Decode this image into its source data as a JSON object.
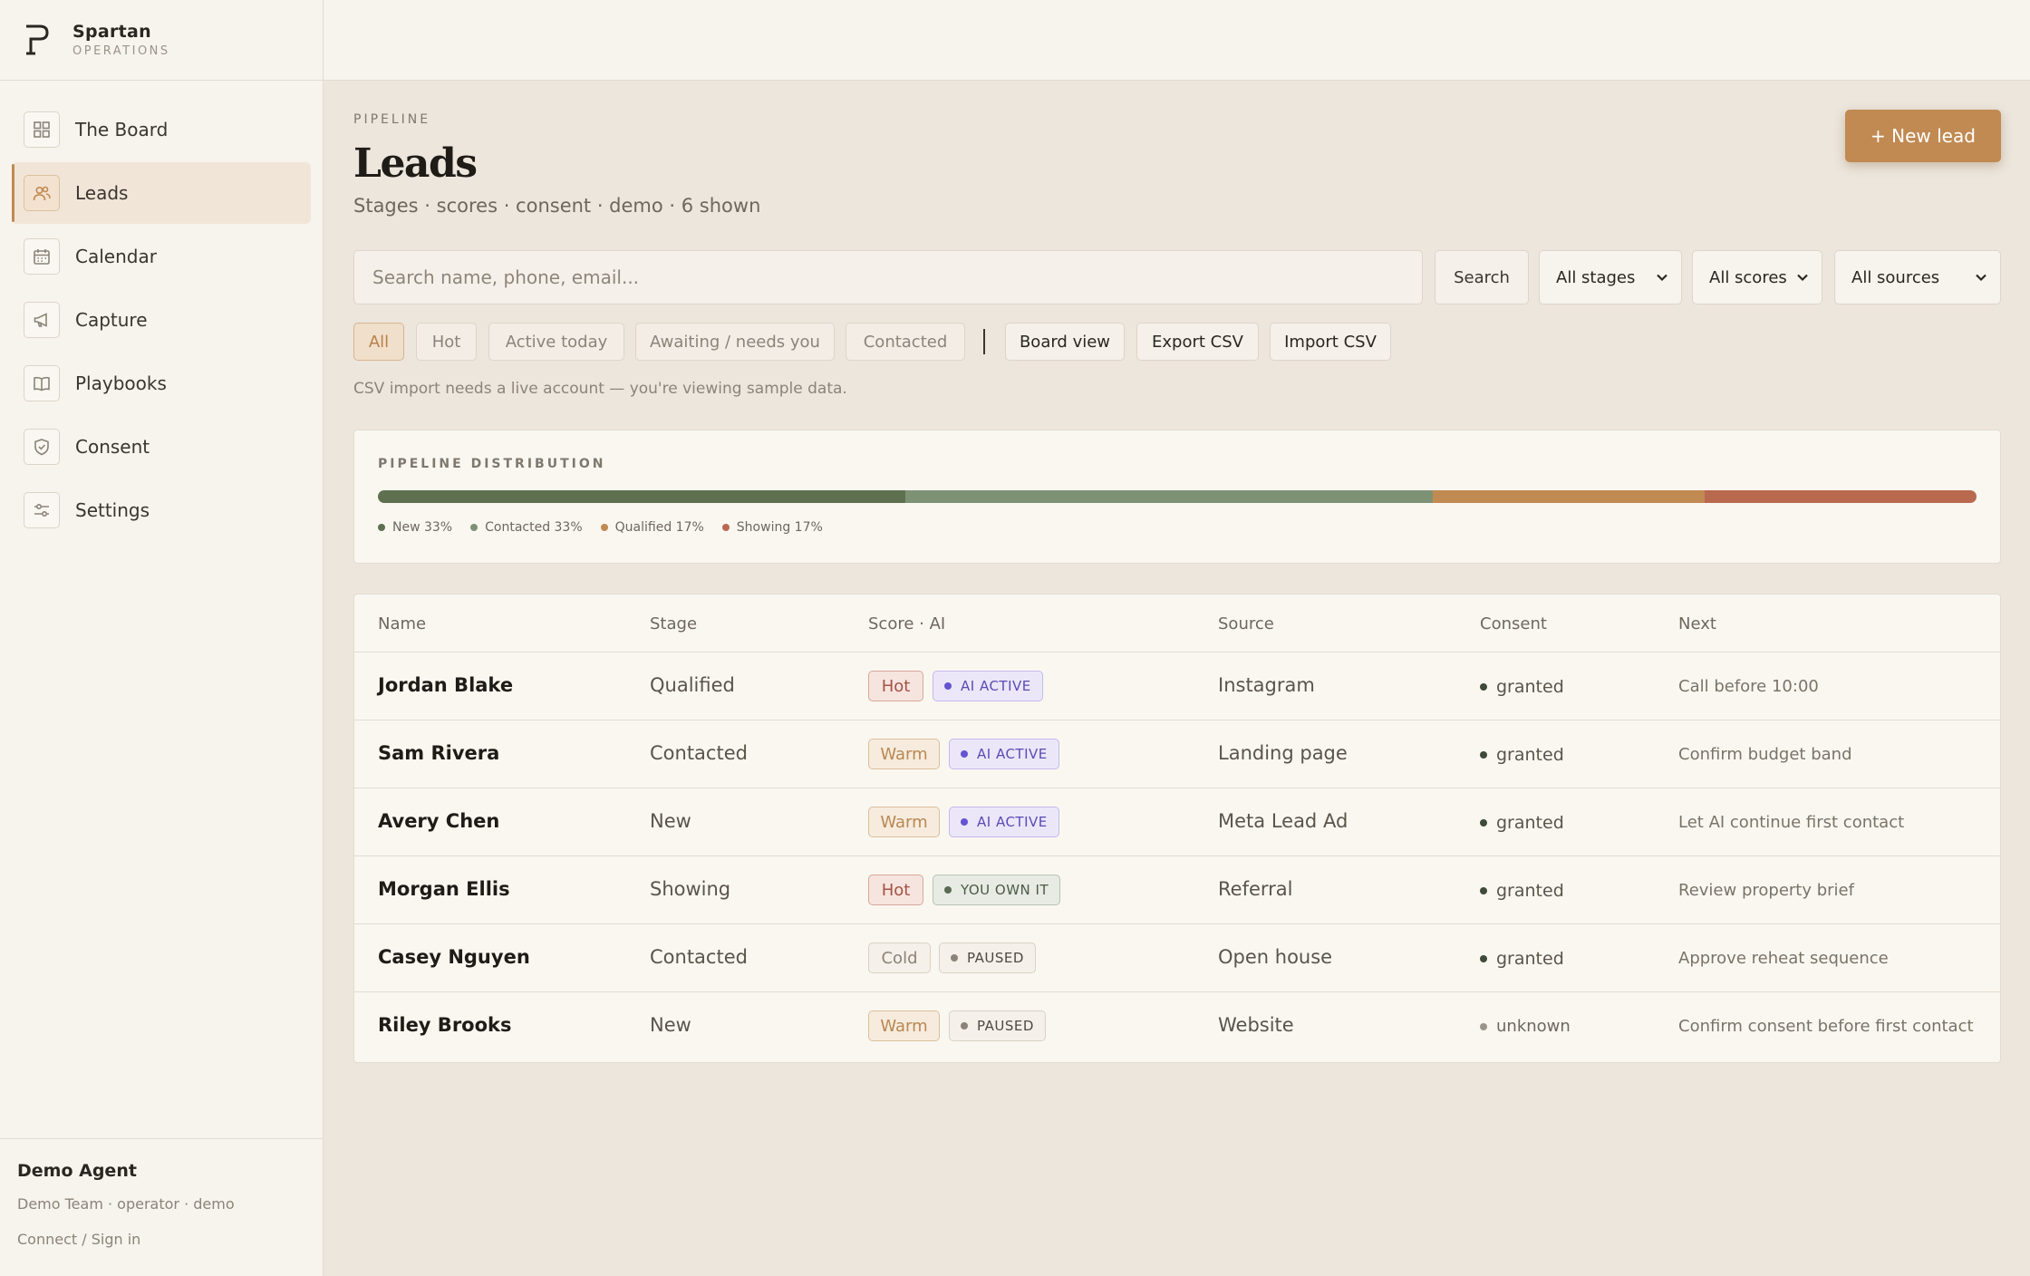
{
  "brand": {
    "name": "Spartan",
    "sub": "OPERATIONS"
  },
  "nav": [
    {
      "label": "The Board",
      "icon": "grid-icon",
      "active": false
    },
    {
      "label": "Leads",
      "icon": "users-icon",
      "active": true
    },
    {
      "label": "Calendar",
      "icon": "calendar-icon",
      "active": false
    },
    {
      "label": "Capture",
      "icon": "megaphone-icon",
      "active": false
    },
    {
      "label": "Playbooks",
      "icon": "book-icon",
      "active": false
    },
    {
      "label": "Consent",
      "icon": "shield-icon",
      "active": false
    },
    {
      "label": "Settings",
      "icon": "sliders-icon",
      "active": false
    }
  ],
  "footer": {
    "agent_name": "Demo Agent",
    "agent_meta": "Demo Team · operator · demo",
    "connect_link": "Connect / Sign in"
  },
  "header": {
    "eyebrow": "PIPELINE",
    "title": "Leads",
    "subtitle": "Stages · scores · consent · demo · 6 shown",
    "new_lead_label": "+ New lead"
  },
  "search": {
    "placeholder": "Search name, phone, email...",
    "button_label": "Search"
  },
  "filters": {
    "stage": "All stages",
    "score": "All scores",
    "source": "All sources"
  },
  "chips": [
    "All",
    "Hot",
    "Active today",
    "Awaiting / needs you",
    "Contacted"
  ],
  "actions": {
    "board_view": "Board view",
    "export_csv": "Export CSV",
    "import_csv": "Import CSV"
  },
  "note": "CSV import needs a live account — you're viewing sample data.",
  "distribution": {
    "label": "PIPELINE DISTRIBUTION",
    "segments": [
      {
        "name": "New",
        "pct": 33,
        "legend": "New 33%",
        "color": "#5e7050"
      },
      {
        "name": "Contacted",
        "pct": 33,
        "legend": "Contacted 33%",
        "color": "#7d9275"
      },
      {
        "name": "Qualified",
        "pct": 17,
        "legend": "Qualified 17%",
        "color": "#c08a52"
      },
      {
        "name": "Showing",
        "pct": 17,
        "legend": "Showing 17%",
        "color": "#b96a4e"
      }
    ]
  },
  "table": {
    "headers": {
      "name": "Name",
      "stage": "Stage",
      "score": "Score · AI",
      "source": "Source",
      "consent": "Consent",
      "next": "Next"
    },
    "rows": [
      {
        "name": "Jordan Blake",
        "stage": "Qualified",
        "score": "Hot",
        "ai": "AI ACTIVE",
        "source": "Instagram",
        "consent": "granted",
        "next": "Call before 10:00"
      },
      {
        "name": "Sam Rivera",
        "stage": "Contacted",
        "score": "Warm",
        "ai": "AI ACTIVE",
        "source": "Landing page",
        "consent": "granted",
        "next": "Confirm budget band"
      },
      {
        "name": "Avery Chen",
        "stage": "New",
        "score": "Warm",
        "ai": "AI ACTIVE",
        "source": "Meta Lead Ad",
        "consent": "granted",
        "next": "Let AI continue first contact"
      },
      {
        "name": "Morgan Ellis",
        "stage": "Showing",
        "score": "Hot",
        "ai": "YOU OWN IT",
        "source": "Referral",
        "consent": "granted",
        "next": "Review property brief"
      },
      {
        "name": "Casey Nguyen",
        "stage": "Contacted",
        "score": "Cold",
        "ai": "PAUSED",
        "source": "Open house",
        "consent": "granted",
        "next": "Approve reheat sequence"
      },
      {
        "name": "Riley Brooks",
        "stage": "New",
        "score": "Warm",
        "ai": "PAUSED",
        "source": "Website",
        "consent": "unknown",
        "next": "Confirm consent before first contact"
      }
    ]
  }
}
